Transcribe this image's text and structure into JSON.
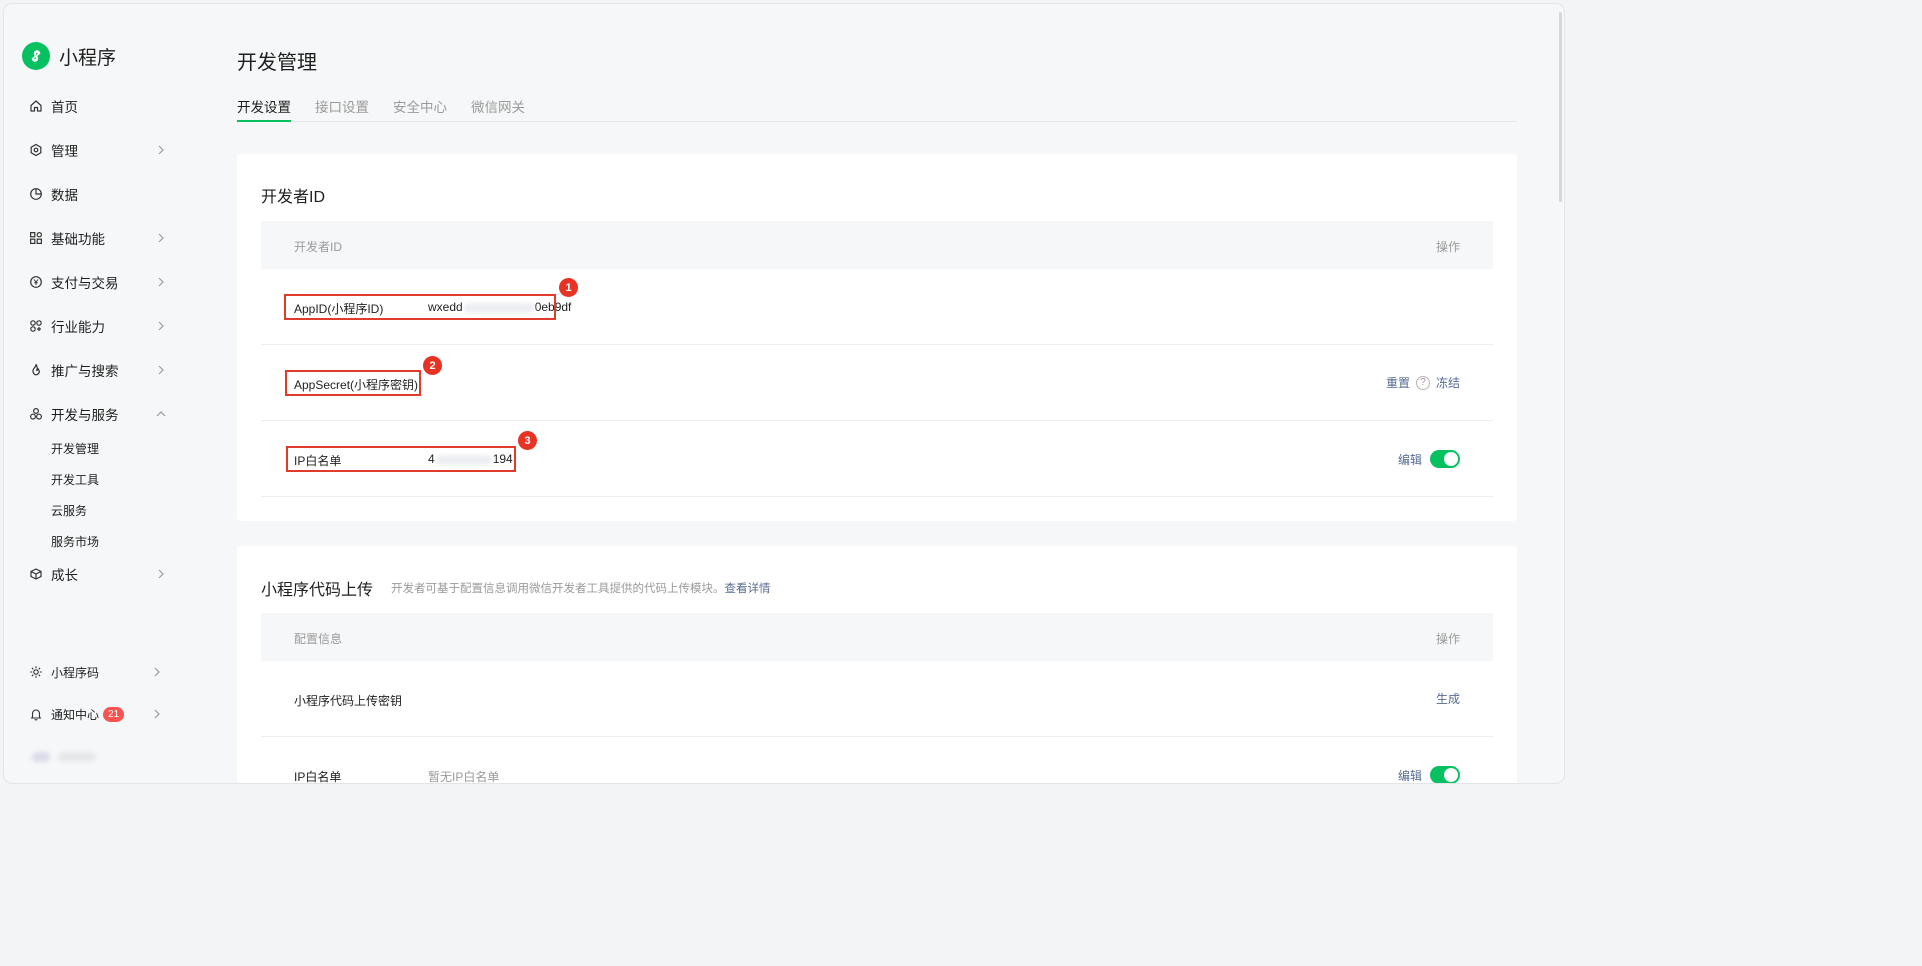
{
  "brand": {
    "name": "小程序"
  },
  "sidebar": {
    "items": [
      {
        "label": "首页"
      },
      {
        "label": "管理"
      },
      {
        "label": "数据"
      },
      {
        "label": "基础功能"
      },
      {
        "label": "支付与交易"
      },
      {
        "label": "行业能力"
      },
      {
        "label": "推广与搜索"
      },
      {
        "label": "开发与服务"
      },
      {
        "label": "成长"
      }
    ],
    "subitems": [
      {
        "label": "开发管理"
      },
      {
        "label": "开发工具"
      },
      {
        "label": "云服务"
      },
      {
        "label": "服务市场"
      }
    ],
    "bottom": [
      {
        "label": "小程序码"
      },
      {
        "label": "通知中心",
        "badge": "21"
      }
    ]
  },
  "page": {
    "title": "开发管理"
  },
  "tabs": [
    {
      "label": "开发设置"
    },
    {
      "label": "接口设置"
    },
    {
      "label": "安全中心"
    },
    {
      "label": "微信网关"
    }
  ],
  "dev_id_card": {
    "title": "开发者ID",
    "header": {
      "left": "开发者ID",
      "right": "操作"
    },
    "rows": [
      {
        "label": "AppID(小程序ID)",
        "value_prefix": "wxedd",
        "value_suffix": "0eb9df",
        "marker": "1"
      },
      {
        "label": "AppSecret(小程序密钥)",
        "marker": "2",
        "actions": {
          "reset": "重置",
          "help": "?",
          "freeze": "冻结"
        }
      },
      {
        "label": "IP白名单",
        "value_prefix": "4",
        "value_suffix": "194",
        "marker": "3",
        "actions": {
          "edit": "编辑"
        }
      }
    ]
  },
  "upload_card": {
    "title": "小程序代码上传",
    "desc": "开发者可基于配置信息调用微信开发者工具提供的代码上传模块。",
    "desc_link": "查看详情",
    "header": {
      "left": "配置信息",
      "right": "操作"
    },
    "rows": [
      {
        "label": "小程序代码上传密钥",
        "action": "生成"
      },
      {
        "label": "IP白名单",
        "value": "暂无IP白名单",
        "action": "编辑"
      }
    ]
  },
  "colors": {
    "accent": "#07c160",
    "link": "#576b95",
    "highlight": "#e33b2b",
    "badge": "#fa5151"
  }
}
